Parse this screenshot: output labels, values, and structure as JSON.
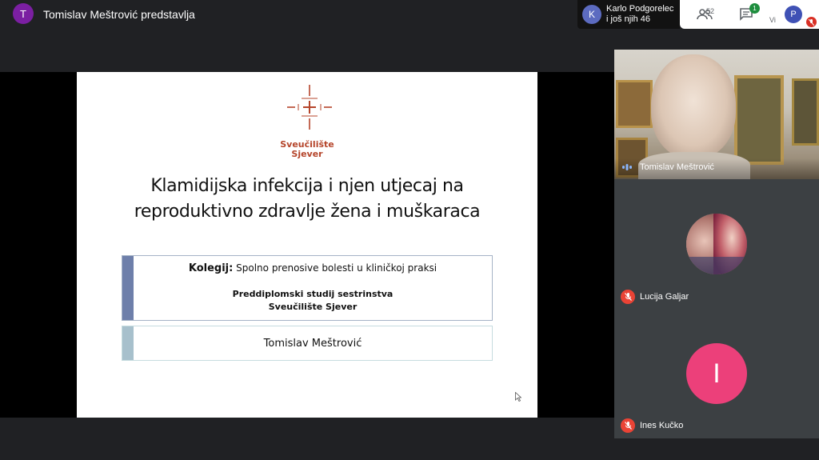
{
  "header": {
    "presenter_initial": "T",
    "presenter_title": "Tomislav Meštrović predstavlja"
  },
  "participants_pill": {
    "avatar_initial": "K",
    "line1": "Karlo Podgorelec",
    "line2": "i još njih 46"
  },
  "toolbar": {
    "people_count": "52",
    "chat_badge": "1",
    "self_label": "Vi",
    "self_initial": "P"
  },
  "slide": {
    "university_line1": "Sveučilište",
    "university_line2": "Sjever",
    "title_line1": "Klamidijska infekcija i njen utjecaj na",
    "title_line2": "reproduktivno zdravlje žena i muškaraca",
    "course_label": "Kolegij:",
    "course_name": " Spolno prenosive bolesti u kliničkoj praksi",
    "study_line1": "Preddiplomski studij sestrinstva",
    "study_line2": "Sveučilište Sjever",
    "author": "Tomislav Meštrović"
  },
  "tiles": [
    {
      "name": "Tomislav Meštrović",
      "status": "speaking"
    },
    {
      "name": "Lucija Galjar",
      "status": "muted"
    },
    {
      "name": "Ines Kučko",
      "status": "muted",
      "avatar_initial": "I"
    }
  ],
  "colors": {
    "presenter_avatar": "#7b1fa2",
    "brand_red": "#b5452b",
    "muted_red": "#ea4335",
    "ines_avatar": "#ec407a",
    "box1_bar": "#6e7faa",
    "box2_bar": "#a7c0cc"
  },
  "icons": [
    "people-icon",
    "chat-icon",
    "mic-off-icon",
    "audio-wave-icon",
    "cursor-icon",
    "university-logo"
  ]
}
